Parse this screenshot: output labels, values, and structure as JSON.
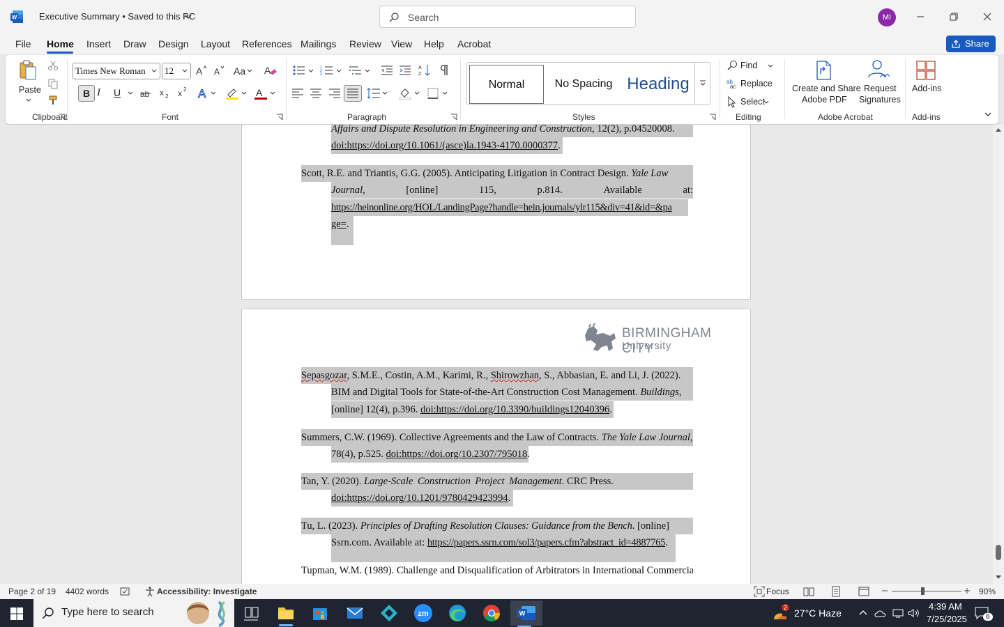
{
  "titlebar": {
    "doc_title": "Executive Summary • Saved to this PC",
    "search_placeholder": "Search",
    "avatar_initials": "MI"
  },
  "menu": {
    "tabs": [
      "File",
      "Home",
      "Insert",
      "Draw",
      "Design",
      "Layout",
      "References",
      "Mailings",
      "Review",
      "View",
      "Help",
      "Acrobat"
    ],
    "active": "Home",
    "share_label": "Share"
  },
  "ribbon": {
    "clipboard": {
      "paste_label": "Paste",
      "group_label": "Clipboard"
    },
    "font": {
      "font_name": "Times New Roman",
      "font_size": "12",
      "case_label": "Aa",
      "group_label": "Font",
      "bold": "B",
      "italic": "I",
      "underline": "U"
    },
    "paragraph": {
      "group_label": "Paragraph"
    },
    "styles": {
      "normal": "Normal",
      "no_spacing": "No Spacing",
      "heading": "Heading",
      "group_label": "Styles"
    },
    "editing": {
      "find": "Find",
      "replace": "Replace",
      "select": "Select",
      "group_label": "Editing"
    },
    "acrobat": {
      "create_share_line1": "Create and Share",
      "create_share_line2": "Adobe PDF",
      "request_line1": "Request",
      "request_line2": "Signatures",
      "group_label": "Adobe Acrobat"
    },
    "addins": {
      "label": "Add-ins",
      "group_label": "Add-ins"
    },
    "colors": {
      "highlight": "#ffe600",
      "font_color": "#c00000",
      "brand_blue": "#185abd"
    }
  },
  "document": {
    "page1": {
      "ref_a_line1": {
        "a": "Affairs and Dispute Resolution in Engineering and Construction",
        "b": ", 12(2), p.04520008."
      },
      "ref_a_line2": "doi:https://doi.org/10.1061/(asce)la.1943-4170.0000377",
      "ref_b_line1": {
        "a": "Scott, R.E. and Triantis, G.G. (2005). Anticipating Litigation in Contract Design.",
        "b": "Yale Law"
      },
      "ref_b_line2": [
        "Journal,",
        "[online]",
        "115,",
        "p.814.",
        "Available",
        "at:"
      ],
      "ref_b_line3": "https://heinonline.org/HOL/LandingPage?handle=hein.journals/ylr115&div=41&id=&pa",
      "ref_b_line4": "ge="
    },
    "logo": {
      "line1": "BIRMINGHAM CITY",
      "line2": "University"
    },
    "page2": {
      "sep_line1": {
        "name": "Sepasgozar",
        "rest": ", S.M.E., Costin, A.M., Karimi, R., ",
        "name2": "Shirowzhan",
        "rest2": ", S., Abbasian, E. and Li, J. (2022)."
      },
      "sep_line2": {
        "a": "BIM and Digital Tools for State-of-the-Art Construction Cost Management.",
        "b": "Buildings"
      },
      "sep_line3": {
        "a": "[online] 12(4), p.396.",
        "b": "doi:https://doi.org/10.3390/buildings12040396"
      },
      "sum_line1": {
        "a": "Summers, C.W. (1969). Collective Agreements and the Law of Contracts.",
        "b": "The Yale Law Journal"
      },
      "sum_line2": {
        "a": "78(4), p.525.",
        "b": "doi:https://doi.org/10.2307/795018"
      },
      "tan_line1": {
        "a": "Tan, Y. (2020).",
        "b": "Large-Scale Construction Project Management",
        "c": ". CRC Press."
      },
      "tan_line2": "doi:https://doi.org/10.1201/9780429423994",
      "tu_line1": {
        "a": "Tu, L. (2023).",
        "b": "Principles of Drafting Resolution Clauses: Guidance from the Bench",
        "c": ". [online]"
      },
      "tu_line2": {
        "a": "Ssrn.com. Available at:",
        "b": "https://papers.ssrn.com/sol3/papers.cfm?abstract_id=4887765"
      },
      "tup_line1": "Tupman, W.M. (1989). Challenge and Disqualification of Arbitrators in International Commercial"
    }
  },
  "statusbar": {
    "page": "Page 2 of 19",
    "words": "4402 words",
    "accessibility": "Accessibility: Investigate",
    "focus": "Focus",
    "zoom": "90%"
  },
  "taskbar": {
    "search_placeholder": "Type here to search",
    "weather_badge": "2",
    "weather": "27°C  Haze",
    "time": "4:39 AM",
    "date": "7/25/2025",
    "notifications": "6"
  }
}
